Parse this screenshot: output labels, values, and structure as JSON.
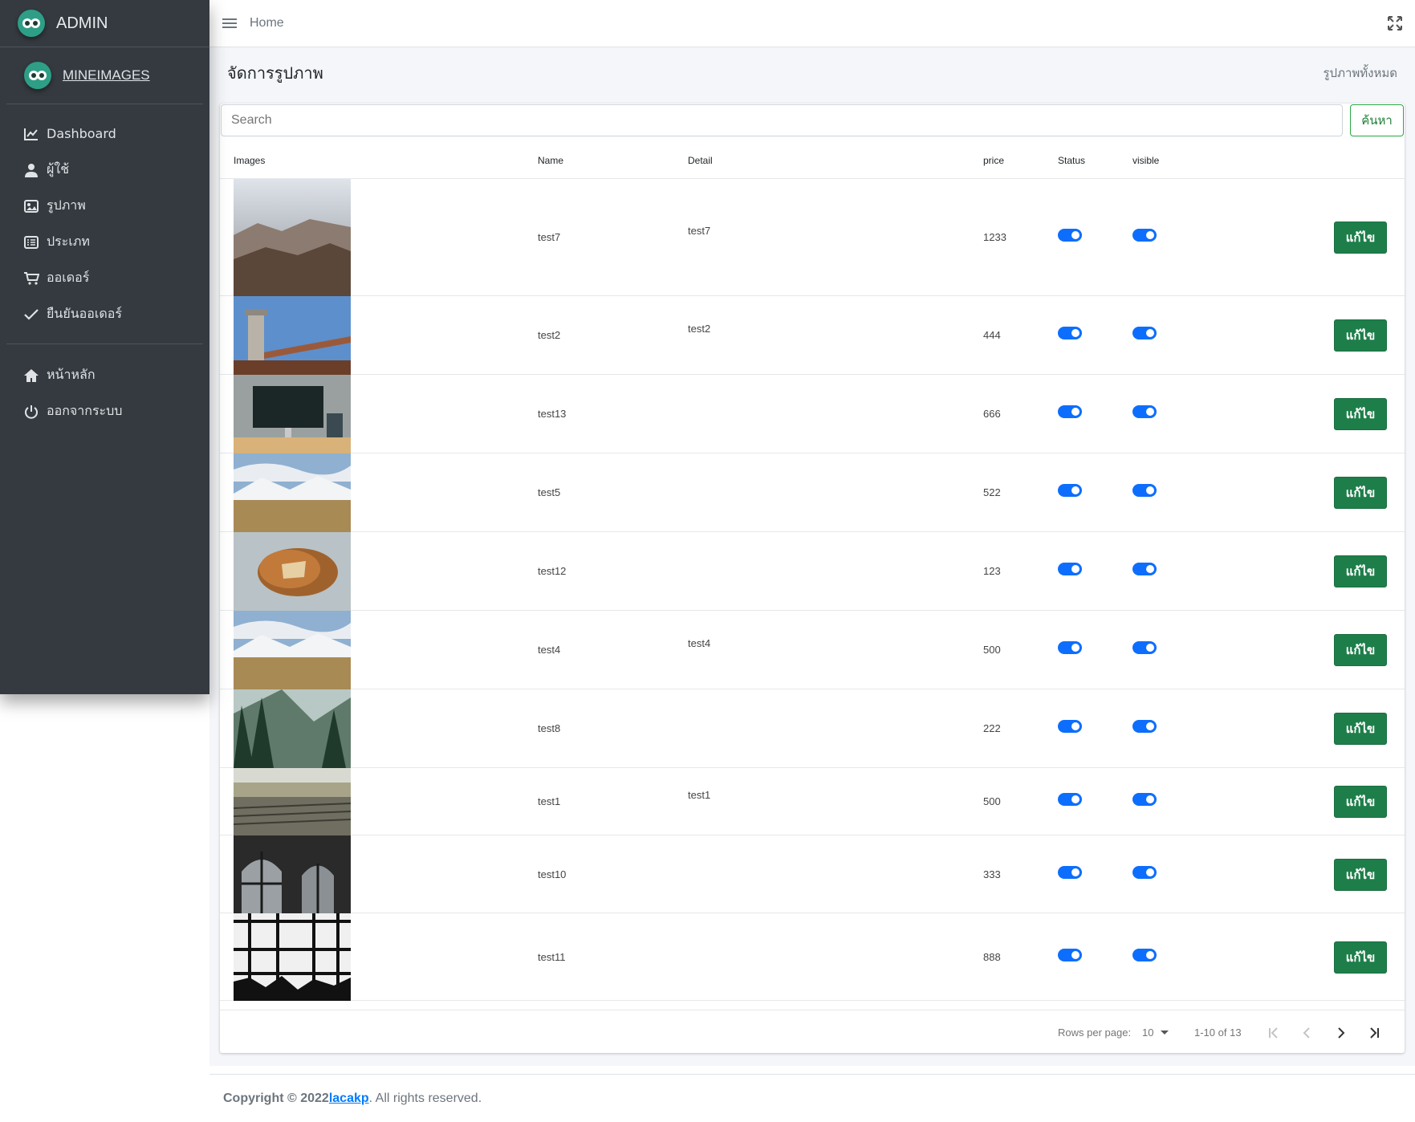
{
  "brand": {
    "title": "ADMIN"
  },
  "user": {
    "name": "MINEIMAGES"
  },
  "sidebar": {
    "items": [
      {
        "label": "Dashboard",
        "icon": "chart-line-icon"
      },
      {
        "label": "ผู้ใช้",
        "icon": "user-icon"
      },
      {
        "label": "รูปภาพ",
        "icon": "image-icon"
      },
      {
        "label": "ประเภท",
        "icon": "list-icon"
      },
      {
        "label": "ออเดอร์",
        "icon": "cart-icon"
      },
      {
        "label": "ยืนยันออเดอร์",
        "icon": "check-icon"
      }
    ],
    "bottom_items": [
      {
        "label": "หน้าหลัก",
        "icon": "home-icon"
      },
      {
        "label": "ออกจากระบบ",
        "icon": "power-icon"
      }
    ]
  },
  "header": {
    "home": "Home"
  },
  "page": {
    "title": "จัดการรูปภาพ",
    "right_link": "รูปภาพทั้งหมด"
  },
  "search": {
    "placeholder": "Search",
    "button": "ค้นหา"
  },
  "table": {
    "columns": [
      "Images",
      "Name",
      "Detail",
      "price",
      "Status",
      "visible"
    ],
    "edit_label": "แก้ไข",
    "rows": [
      {
        "name": "test7",
        "detail": "test7",
        "price": "1233",
        "status": true,
        "visible": true,
        "image": "mountain-aerial"
      },
      {
        "name": "test2",
        "detail": "test2",
        "price": "444",
        "status": true,
        "visible": true,
        "image": "industrial-tower"
      },
      {
        "name": "test13",
        "detail": "",
        "price": "666",
        "status": true,
        "visible": true,
        "image": "desk-monitor"
      },
      {
        "name": "test5",
        "detail": "",
        "price": "522",
        "status": true,
        "visible": true,
        "image": "mountain-field"
      },
      {
        "name": "test12",
        "detail": "",
        "price": "123",
        "status": true,
        "visible": true,
        "image": "bread"
      },
      {
        "name": "test4",
        "detail": "test4",
        "price": "500",
        "status": true,
        "visible": true,
        "image": "mountain-field"
      },
      {
        "name": "test8",
        "detail": "",
        "price": "222",
        "status": true,
        "visible": true,
        "image": "forest-valley"
      },
      {
        "name": "test1",
        "detail": "test1",
        "price": "500",
        "status": true,
        "visible": true,
        "image": "rail-yard"
      },
      {
        "name": "test10",
        "detail": "",
        "price": "333",
        "status": true,
        "visible": true,
        "image": "arched-windows"
      },
      {
        "name": "test11",
        "detail": "",
        "price": "888",
        "status": true,
        "visible": true,
        "image": "window-silhouette"
      }
    ]
  },
  "pagination": {
    "rows_per_page_label": "Rows per page:",
    "rows_per_page": "10",
    "range": "1-10 of 13"
  },
  "footer": {
    "copyright": "Copyright © 2022",
    "link": "lacakp",
    "rights": ". All rights reserved."
  },
  "colors": {
    "sidebar_bg": "#343a40",
    "toggle_on": "#0d6efd",
    "edit_button": "#1e7e4a",
    "search_button_border": "#28a745"
  }
}
